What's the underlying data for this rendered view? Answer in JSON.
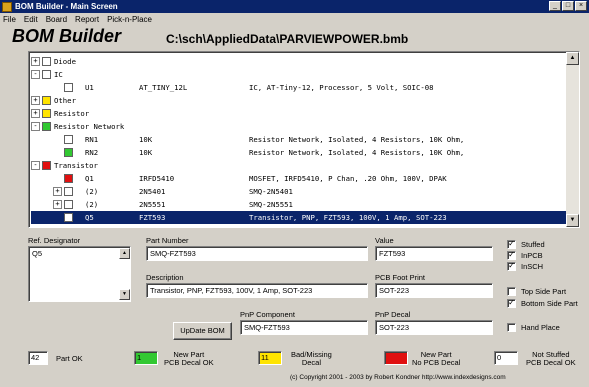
{
  "window": {
    "title": "BOM Builder - Main Screen",
    "controls": [
      "_",
      "□",
      "×"
    ]
  },
  "menu": [
    "File",
    "Edit",
    "Board",
    "Report",
    "Pick-n-Place"
  ],
  "header": {
    "app_title": "BOM Builder",
    "file_path": "C:\\sch\\AppliedData\\PARVIEWPOWER.bmb"
  },
  "tree": {
    "rows": [
      {
        "toggle": "+",
        "color": "#ffffff",
        "label": "Diode"
      },
      {
        "toggle": "-",
        "color": "#ffffff",
        "label": "IC"
      },
      {
        "toggle": "",
        "color": "#ffffff",
        "designator": "U1",
        "value": "AT_TINY_12L",
        "description": "IC, AT-Tiny-12, Processor, 5 Volt, SOIC-08"
      },
      {
        "toggle": "+",
        "color": "#ffe400",
        "label": "Other"
      },
      {
        "toggle": "+",
        "color": "#ffe400",
        "label": "Resistor"
      },
      {
        "toggle": "-",
        "color": "#32c832",
        "label": "Resistor Network"
      },
      {
        "toggle": "",
        "color": "#ffffff",
        "designator": "RN1",
        "value": "10K",
        "description": "Resistor Network, Isolated, 4 Resistors, 10K Ohm,"
      },
      {
        "toggle": "",
        "color": "#32c832",
        "designator": "RN2",
        "value": "10K",
        "description": "Resistor Network, Isolated, 4 Resistors, 10K Ohm,"
      },
      {
        "toggle": "-",
        "color": "#e01010",
        "label": "Transistor"
      },
      {
        "toggle": "",
        "color": "#e01010",
        "designator": "Q1",
        "value": "IRFD5410",
        "description": "MOSFET, IRFD5410, P Chan, .20 Ohm, 100V, DPAK"
      },
      {
        "toggle": "+",
        "color": "#ffffff",
        "designator": "(2)",
        "value": "2N5401",
        "description": "SMQ-2N5401"
      },
      {
        "toggle": "+",
        "color": "#ffffff",
        "designator": "(2)",
        "value": "2N5551",
        "description": "SMQ-2N5551"
      },
      {
        "toggle": "",
        "color": "#ffffff",
        "designator": "Q5",
        "value": "FZT593",
        "description": "Transistor, PNP, FZT593, 100V, 1 Amp, SOT-223",
        "selected": true
      }
    ]
  },
  "form": {
    "ref_designator_label": "Ref. Designator",
    "ref_designator_value": "Q5",
    "part_number_label": "Part Number",
    "part_number_value": "SMQ-FZT593",
    "value_label": "Value",
    "value_value": "FZT593",
    "description_label": "Description",
    "description_value": "Transistor, PNP, FZT593, 100V, 1 Amp, SOT-223",
    "pcb_footprint_label": "PCB Foot Print",
    "pcb_footprint_value": "SOT-223",
    "pnp_component_label": "PnP Component",
    "pnp_component_value": "SMQ-FZT593",
    "pnp_decal_label": "PnP Decal",
    "pnp_decal_value": "SOT-223",
    "update_button": "UpDate BOM"
  },
  "checkboxes": {
    "stuffed": {
      "label": "Stuffed",
      "checked": true
    },
    "inpcb": {
      "label": "InPCB",
      "checked": true
    },
    "insch": {
      "label": "InSCH",
      "checked": true
    },
    "top_side": {
      "label": "Top Side Part",
      "checked": false
    },
    "bottom_side": {
      "label": "Bottom Side Part",
      "checked": true
    },
    "hand_place": {
      "label": "Hand Place",
      "checked": false
    },
    "check_mark": "✓"
  },
  "legend": {
    "part_ok_count": "42",
    "part_ok_label": "Part OK",
    "new_part_count": "1",
    "new_part_label_1": "New Part",
    "new_part_label_2": "PCB Decal OK",
    "bad_decal_count": "11",
    "bad_decal_label_1": "Bad/Missing",
    "bad_decal_label_2": "Decal",
    "no_decal_count": "",
    "no_decal_label_1": "New Part",
    "no_decal_label_2": "No PCB Decal",
    "not_stuffed_count": "0",
    "not_stuffed_label_1": "Not Stuffed",
    "not_stuffed_label_2": "PCB Decal OK",
    "colors": {
      "new_part": "#32c832",
      "bad_decal": "#ffe400",
      "no_decal": "#e01010",
      "part_ok": "#ffffff",
      "not_stuffed": "#ffffff"
    }
  },
  "footer": {
    "copyright": "(c) Copyright 2001 - 2003 by Robert Kondner   http://www.indexdesigns.com"
  }
}
